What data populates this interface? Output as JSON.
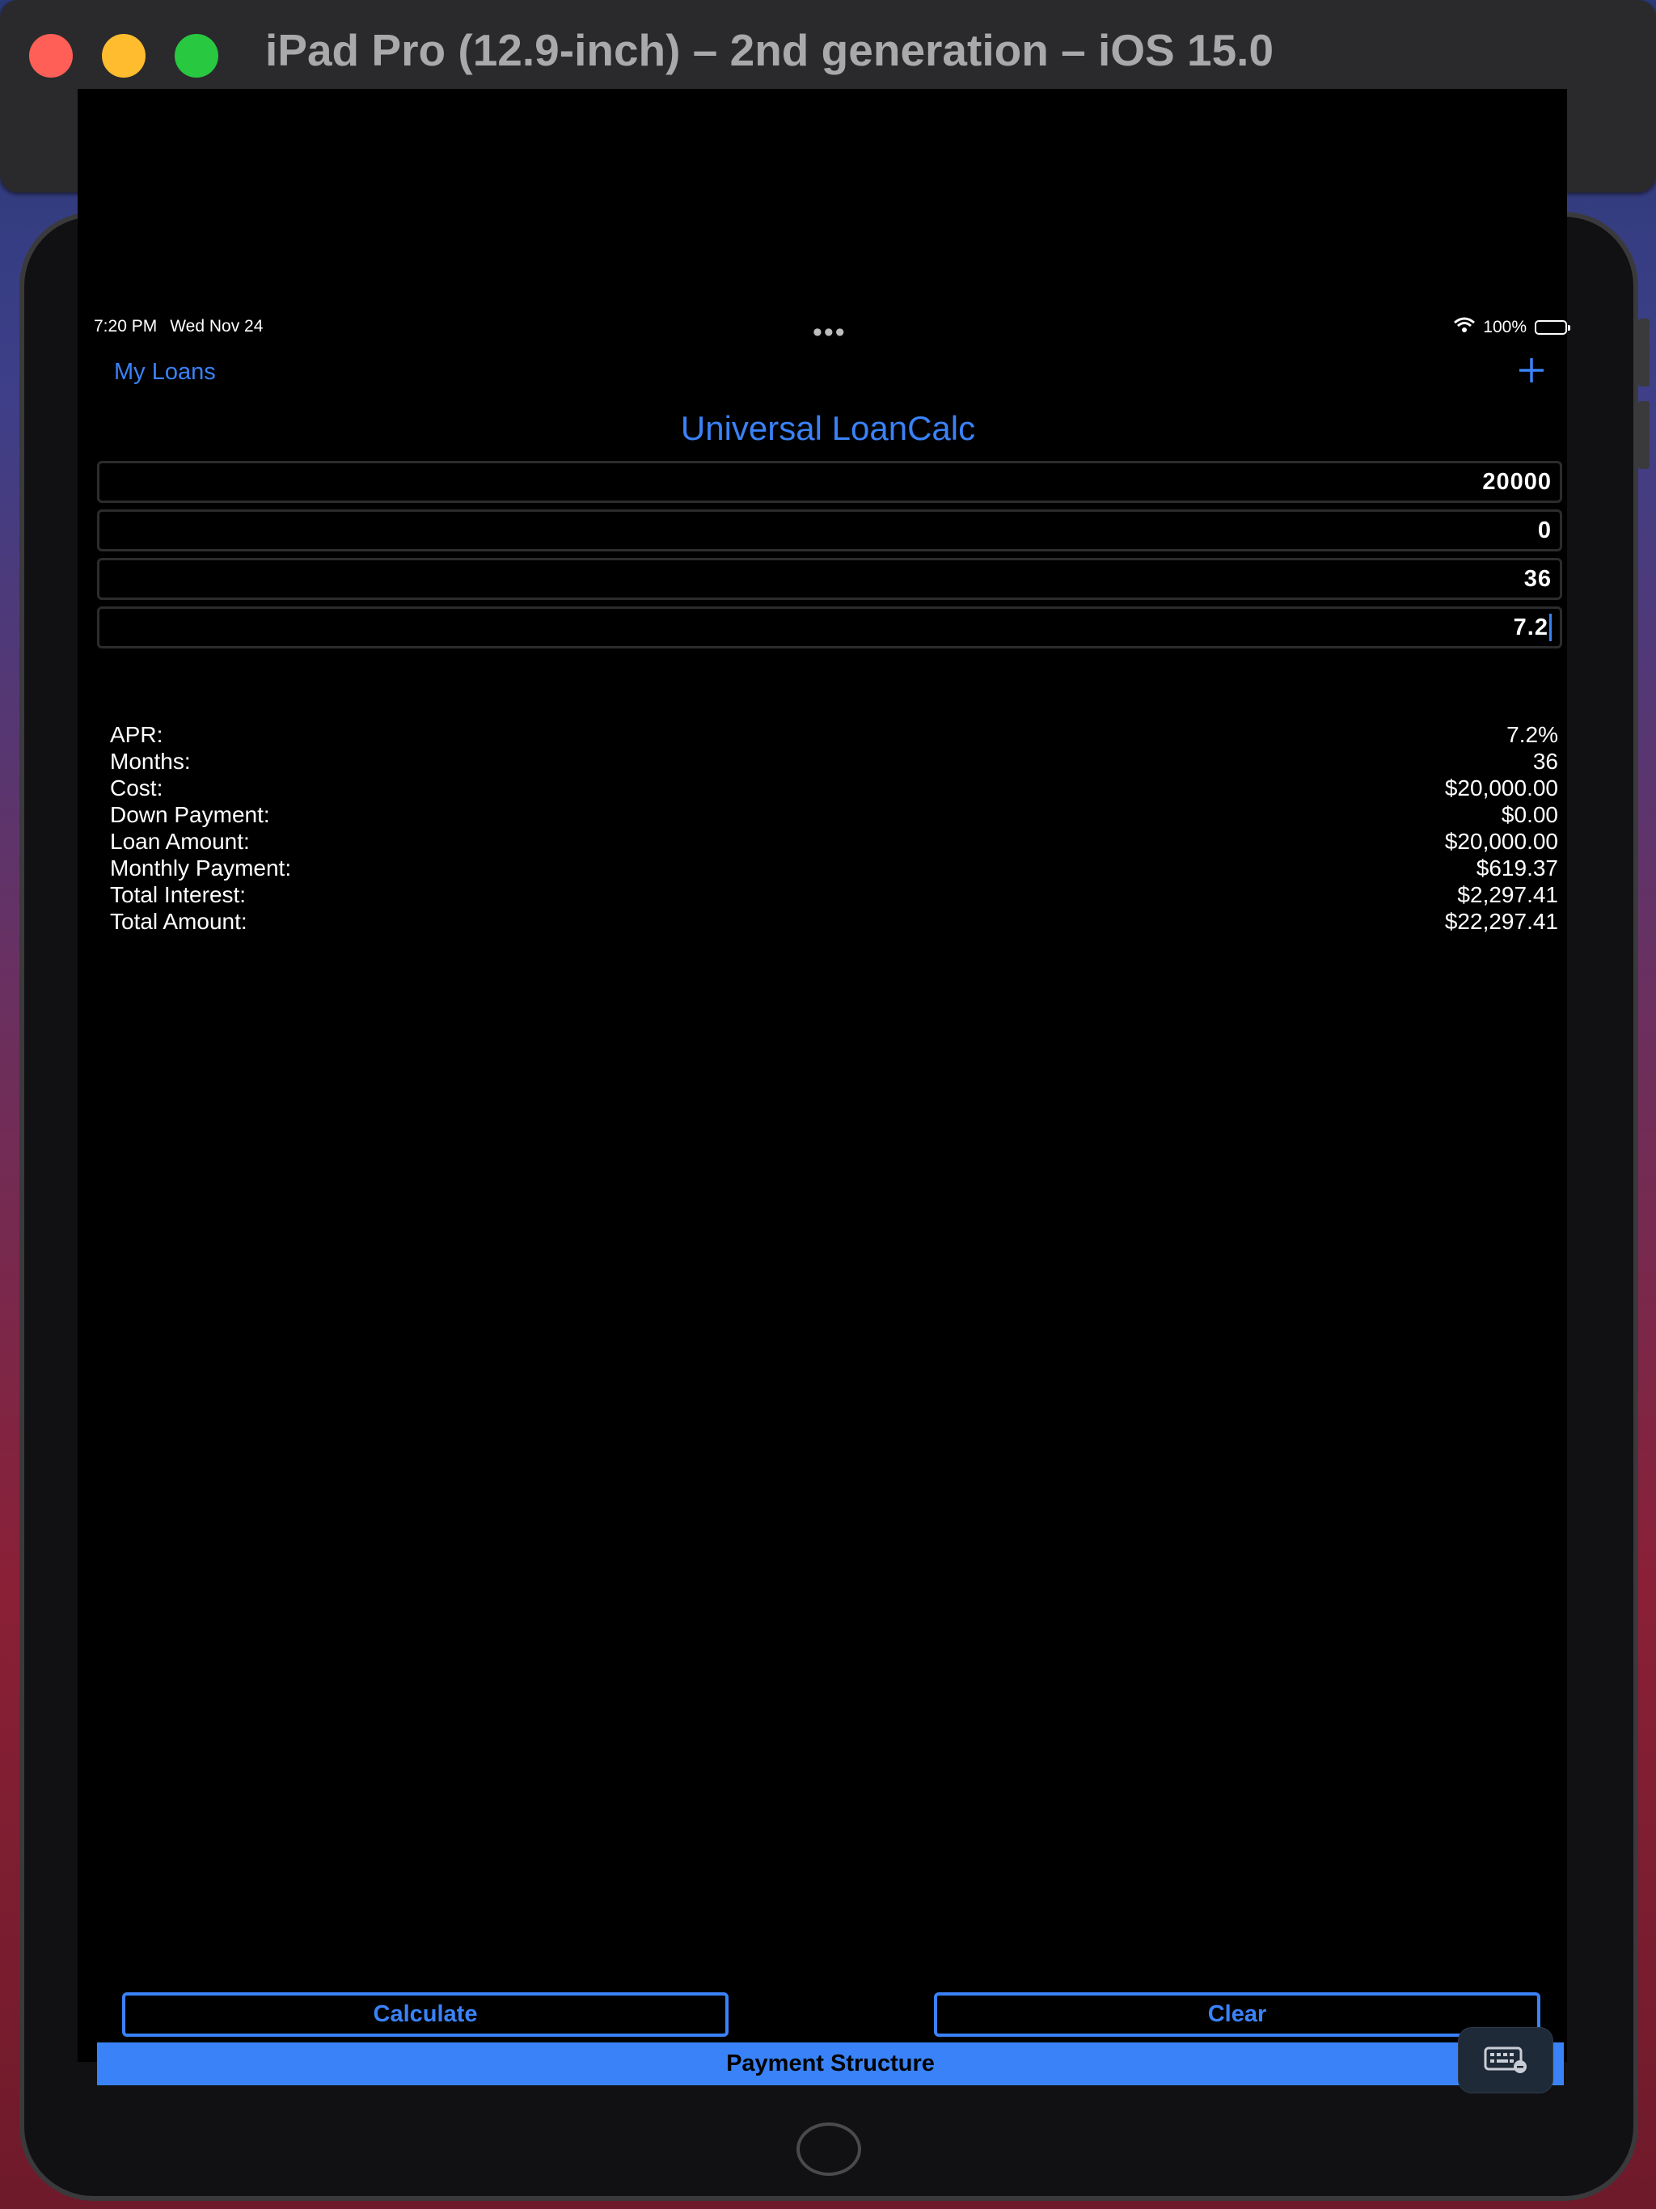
{
  "window": {
    "title": "iPad Pro (12.9-inch) – 2nd generation – iOS 15.0"
  },
  "toolbar": {
    "icons": [
      "home-icon",
      "screenshot-icon",
      "rotate-icon",
      "appearance-icon",
      "command-icon"
    ]
  },
  "status_bar": {
    "time": "7:20 PM",
    "date": "Wed Nov 24",
    "dots": "•••",
    "battery_text": "100%"
  },
  "nav": {
    "back_label": "My Loans",
    "add_icon": "plus-icon",
    "title": "Universal LoanCalc"
  },
  "fields": [
    {
      "value": "20000"
    },
    {
      "value": "0"
    },
    {
      "value": "36"
    },
    {
      "value": "7.2"
    }
  ],
  "results": [
    {
      "label": "APR:",
      "value": "7.2%"
    },
    {
      "label": "Months:",
      "value": "36"
    },
    {
      "label": "Cost:",
      "value": "$20,000.00"
    },
    {
      "label": "Down Payment:",
      "value": "$0.00"
    },
    {
      "label": "Loan Amount:",
      "value": "$20,000.00"
    },
    {
      "label": "Monthly Payment:",
      "value": "$619.37"
    },
    {
      "label": "Total Interest:",
      "value": "$2,297.41"
    },
    {
      "label": "Total Amount:",
      "value": "$22,297.41"
    }
  ],
  "buttons": {
    "calculate": "Calculate",
    "clear": "Clear",
    "payment_structure": "Payment Structure"
  },
  "colors": {
    "accent": "#3a82f7",
    "background": "#000000",
    "text": "#ffffff"
  }
}
